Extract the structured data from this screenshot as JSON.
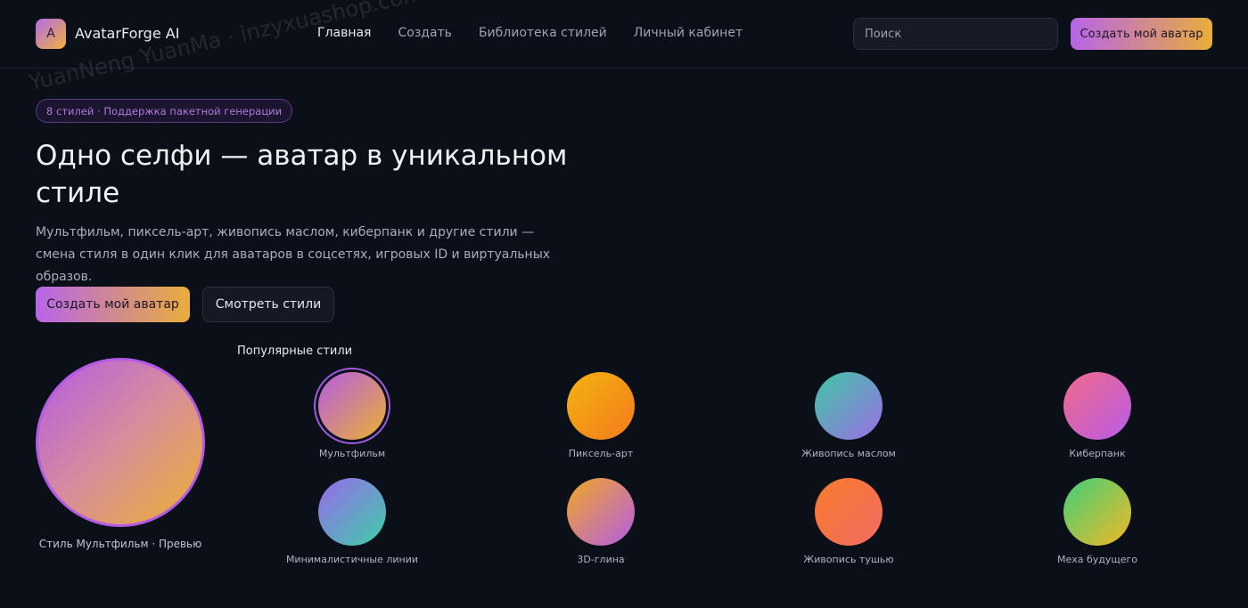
{
  "header": {
    "logo_letter": "A",
    "app_name": "AvatarForge AI",
    "nav": [
      {
        "label": "Главная",
        "active": true
      },
      {
        "label": "Создать",
        "active": false
      },
      {
        "label": "Библиотека стилей",
        "active": false
      },
      {
        "label": "Личный кабинет",
        "active": false
      }
    ],
    "search_placeholder": "Поиск",
    "cta_label": "Создать мой аватар"
  },
  "hero": {
    "badge": "8 стилей · Поддержка пакетной генерации",
    "title": "Одно селфи — аватар в уникальном стиле",
    "description": "Мультфильм, пиксель-арт, живопись маслом, киберпанк и другие стили — смена стиля в один клик для аватаров в соцсетях, игровых ID и виртуальных образов.",
    "primary_button": "Создать мой аватар",
    "secondary_button": "Смотреть стили"
  },
  "preview": {
    "caption": "Стиль Мультфильм · Превью"
  },
  "styles": {
    "title": "Популярные стили",
    "items": [
      {
        "label": "Мультфильм",
        "selected": true,
        "colors": [
          "#b45be6",
          "#ecb12f"
        ]
      },
      {
        "label": "Пиксель-арт",
        "selected": false,
        "colors": [
          "#f3b311",
          "#f47b1c"
        ]
      },
      {
        "label": "Живопись маслом",
        "selected": false,
        "colors": [
          "#3fc8a4",
          "#9b6de6"
        ]
      },
      {
        "label": "Киберпанк",
        "selected": false,
        "colors": [
          "#f16a8a",
          "#b85be6"
        ]
      },
      {
        "label": "Минималистичные линии",
        "selected": false,
        "colors": [
          "#9a68ec",
          "#3dcfa8"
        ]
      },
      {
        "label": "3D-глина",
        "selected": false,
        "colors": [
          "#f1a822",
          "#b45be6"
        ]
      },
      {
        "label": "Живопись тушью",
        "selected": false,
        "colors": [
          "#f97a2a",
          "#f06c63"
        ]
      },
      {
        "label": "Меха будущего",
        "selected": false,
        "colors": [
          "#40d07a",
          "#f2b825"
        ]
      }
    ]
  },
  "watermark": "YuanNeng YuanMa · inzyxuashop.com"
}
